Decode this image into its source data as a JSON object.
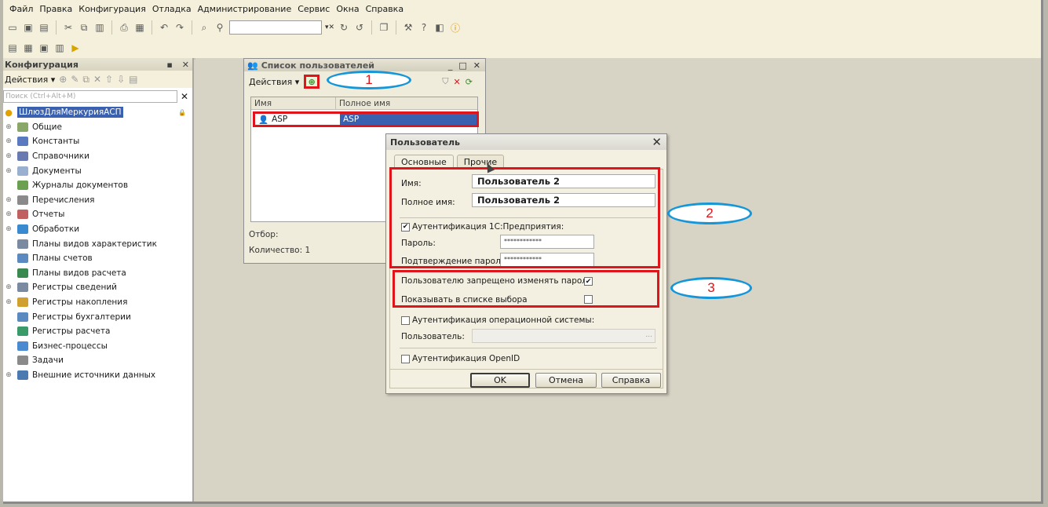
{
  "menu": [
    "Файл",
    "Правка",
    "Конфигурация",
    "Отладка",
    "Администрирование",
    "Сервис",
    "Окна",
    "Справка"
  ],
  "config_panel": {
    "title": "Конфигурация",
    "actions_label": "Действия",
    "search_placeholder": "Поиск (Ctrl+Alt+M)",
    "root": "ШлюзДляМеркурияАСП",
    "items": [
      {
        "label": "Общие",
        "expandable": true
      },
      {
        "label": "Константы",
        "expandable": true
      },
      {
        "label": "Справочники",
        "expandable": true
      },
      {
        "label": "Документы",
        "expandable": true
      },
      {
        "label": "Журналы документов",
        "expandable": false
      },
      {
        "label": "Перечисления",
        "expandable": true
      },
      {
        "label": "Отчеты",
        "expandable": true
      },
      {
        "label": "Обработки",
        "expandable": true
      },
      {
        "label": "Планы видов характеристик",
        "expandable": false
      },
      {
        "label": "Планы счетов",
        "expandable": false
      },
      {
        "label": "Планы видов расчета",
        "expandable": false
      },
      {
        "label": "Регистры сведений",
        "expandable": true
      },
      {
        "label": "Регистры накопления",
        "expandable": true
      },
      {
        "label": "Регистры бухгалтерии",
        "expandable": false
      },
      {
        "label": "Регистры расчета",
        "expandable": false
      },
      {
        "label": "Бизнес-процессы",
        "expandable": false
      },
      {
        "label": "Задачи",
        "expandable": false
      },
      {
        "label": "Внешние источники данных",
        "expandable": true
      }
    ]
  },
  "users_list": {
    "title": "Список пользователей",
    "actions_label": "Действия",
    "col_name": "Имя",
    "col_full_name": "Полное имя",
    "row": {
      "name": "ASP",
      "full_name": "ASP"
    },
    "filter_label": "Отбор:",
    "count_label": "Количество: 1"
  },
  "user_dialog": {
    "title": "Пользователь",
    "tab_main": "Основные",
    "tab_other": "Прочие",
    "name_label": "Имя:",
    "name_value": "Пользователь 2",
    "full_name_label": "Полное имя:",
    "full_name_value": "Пользователь 2",
    "auth_1c_label": "Аутентификация 1С:Предприятия:",
    "auth_1c_checked": true,
    "password_label": "Пароль:",
    "password_value": "************",
    "confirm_label": "Подтверждение пароля:",
    "confirm_value": "************",
    "forbid_change_label": "Пользователю запрещено изменять пароль",
    "forbid_change_checked": true,
    "show_in_list_label": "Показывать в списке выбора",
    "show_in_list_checked": false,
    "os_auth_label": "Аутентификация операционной системы:",
    "os_user_label": "Пользователь:",
    "openid_label": "Аутентификация OpenID",
    "ok_label": "OK",
    "cancel_label": "Отмена",
    "help_label": "Справка"
  },
  "annotations": {
    "one": "1",
    "two": "2",
    "three": "3"
  },
  "colors": {
    "highlight_red": "#e0141b",
    "oval_blue": "#1596d8",
    "selection_blue": "#3a60b0"
  }
}
